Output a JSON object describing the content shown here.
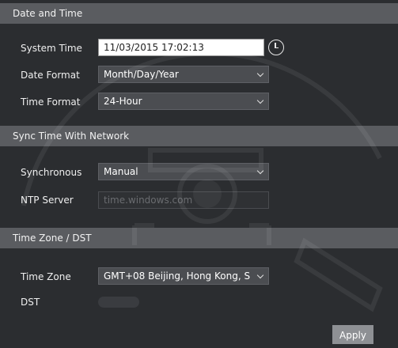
{
  "sections": {
    "date_time": "Date and Time",
    "sync": "Sync Time With Network",
    "timezone": "Time Zone / DST"
  },
  "fields": {
    "system_time_label": "System Time",
    "system_time_value": "11/03/2015 17:02:13",
    "date_format_label": "Date Format",
    "date_format_value": "Month/Day/Year",
    "time_format_label": "Time Format",
    "time_format_value": "24-Hour",
    "synchronous_label": "Synchronous",
    "synchronous_value": "Manual",
    "ntp_label": "NTP Server",
    "ntp_value": "time.windows.com",
    "timezone_label": "Time Zone",
    "timezone_value": "GMT+08 Beijing, Hong Kong, S",
    "dst_label": "DST"
  },
  "buttons": {
    "apply": "Apply"
  },
  "icons": {
    "system_time_button": "clock-icon",
    "dropdown": "chevron-down-icon"
  },
  "colors": {
    "background": "#2b2d30",
    "section_header": "#5a5c60",
    "field": "#4b4d51",
    "apply_button": "#8e9094"
  }
}
